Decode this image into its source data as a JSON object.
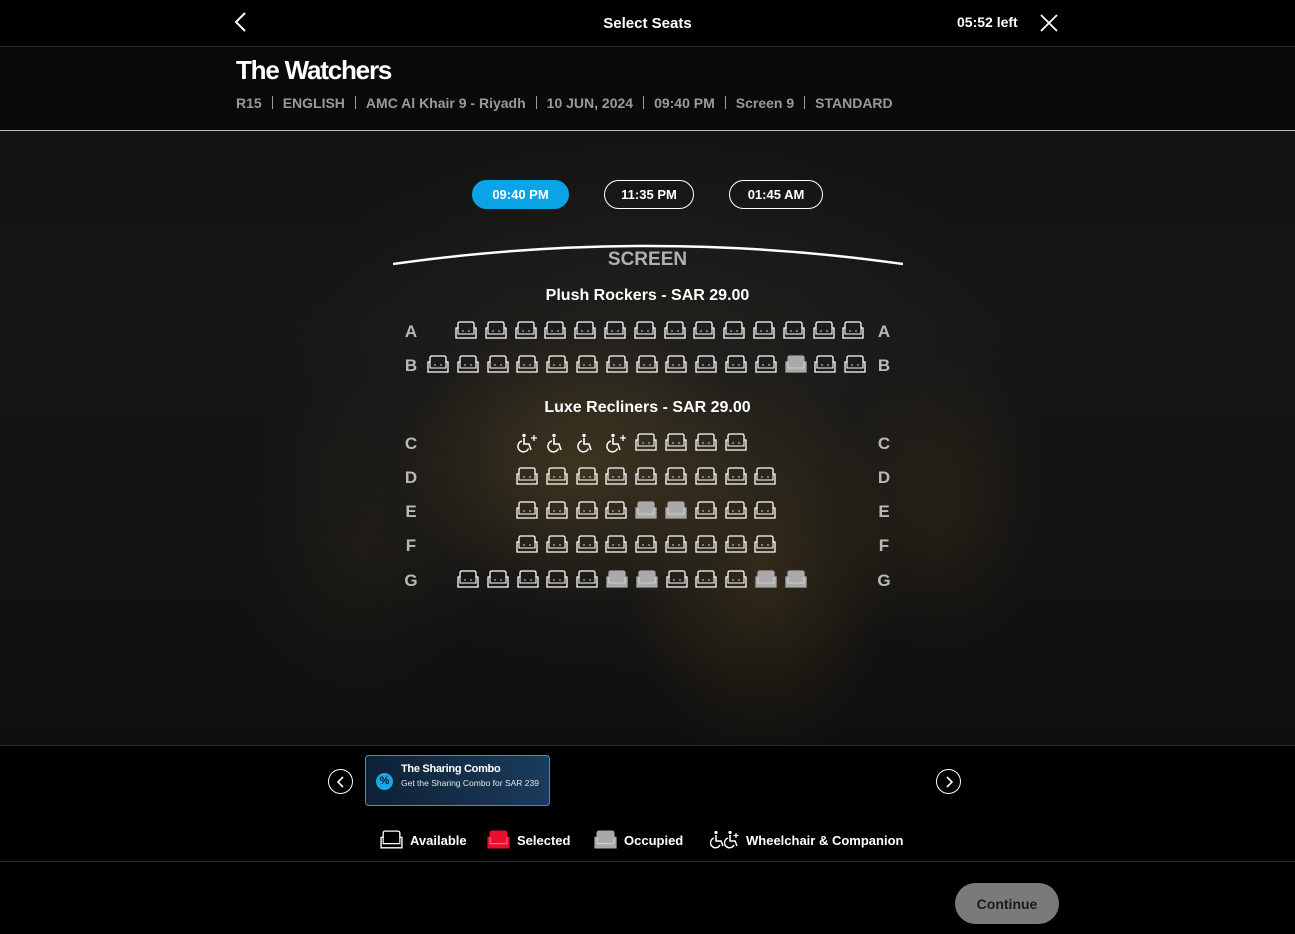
{
  "header": {
    "title": "Select Seats",
    "timer": "05:52 left"
  },
  "movie": {
    "title": "The Watchers",
    "meta": [
      "R15",
      "ENGLISH",
      "AMC Al Khair 9 - Riyadh",
      "10 JUN, 2024",
      "09:40 PM",
      "Screen 9",
      "STANDARD"
    ]
  },
  "showtimes": [
    {
      "label": "09:40 PM",
      "active": true
    },
    {
      "label": "11:35 PM",
      "active": false
    },
    {
      "label": "01:45 AM",
      "active": false
    }
  ],
  "screen_label": "SCREEN",
  "sections": [
    {
      "title": "Plush Rockers -  SAR  29.00",
      "rows": [
        {
          "letter": "A",
          "seats": [
            "o",
            "a",
            "a",
            "a",
            "a",
            "a",
            "a",
            "a",
            "a",
            "a",
            "a",
            "a",
            "a",
            "a"
          ]
        },
        {
          "letter": "B",
          "seats": [
            "a",
            "a",
            "a",
            "a",
            "a",
            "a",
            "a",
            "a",
            "a",
            "a",
            "a",
            "a",
            "x",
            "a",
            "a"
          ]
        }
      ]
    },
    {
      "title": "Luxe Recliners -  SAR  29.00",
      "rows": [
        {
          "letter": "C",
          "seats": [
            "wc",
            "w",
            "w",
            "wc",
            "a",
            "a",
            "a",
            "a"
          ]
        },
        {
          "letter": "D",
          "seats": [
            "a",
            "a",
            "a",
            "a",
            "a",
            "a",
            "a",
            "a",
            "a"
          ]
        },
        {
          "letter": "E",
          "seats": [
            "a",
            "a",
            "a",
            "a",
            "x",
            "x",
            "a",
            "a",
            "a"
          ]
        },
        {
          "letter": "F",
          "seats": [
            "a",
            "a",
            "a",
            "a",
            "a",
            "a",
            "a",
            "a",
            "a"
          ]
        },
        {
          "letter": "G",
          "seats": [
            "a",
            "a",
            "a",
            "a",
            "a",
            "x",
            "x",
            "a",
            "a",
            "a",
            "x",
            "x"
          ]
        }
      ]
    }
  ],
  "seat_colors": {
    "available": "#ffffff",
    "selected": "#e8102e",
    "occupied": "#a9a9a9"
  },
  "promo": {
    "icon": "discount-icon",
    "title": "The Sharing Combo",
    "desc": "Get the Sharing Combo for SAR 239"
  },
  "legend": {
    "available": "Available",
    "selected": "Selected",
    "occupied": "Occupied",
    "wheelchair": "Wheelchair & Companion"
  },
  "footer": {
    "continue_label": "Continue"
  },
  "colors": {
    "accent": "#0aa3e6",
    "button_disabled": "#7a7a7a"
  }
}
